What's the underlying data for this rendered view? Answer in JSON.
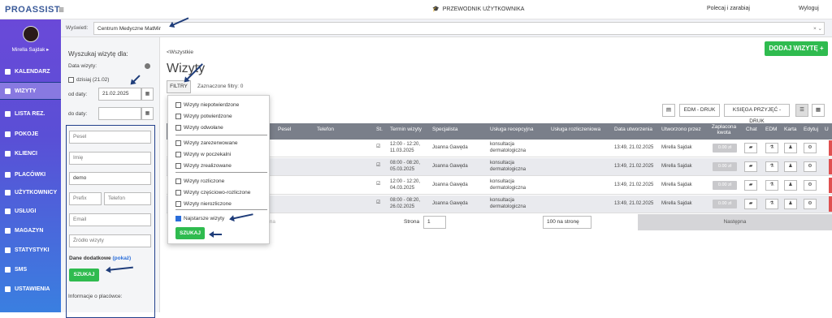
{
  "top": {
    "logo": "PROASSIST",
    "guide": "PRZEWODNIK UŻYTKOWNIKA",
    "refer": "Polecaj i zarabiaj",
    "logout": "Wyloguj"
  },
  "user": {
    "name": "Mirella Sajdak ▸"
  },
  "nav": [
    {
      "label": "KALENDARZ",
      "icon": "calendar-icon"
    },
    {
      "label": "WIZYTY",
      "icon": "list-icon"
    },
    {
      "label": "LISTA REZ.",
      "icon": "list-icon"
    },
    {
      "label": "POKOJE",
      "icon": "room-icon"
    },
    {
      "label": "KLIENCI",
      "icon": "users-icon"
    },
    {
      "label": "PLACÓWKI",
      "icon": "location-icon"
    },
    {
      "label": "UŻYTKOWNICY",
      "icon": "user-icon"
    },
    {
      "label": "USŁUGI",
      "icon": "grid-icon"
    },
    {
      "label": "MAGAZYN",
      "icon": "box-icon"
    },
    {
      "label": "STATYSTYKI",
      "icon": "chart-icon"
    },
    {
      "label": "SMS",
      "icon": "sms-icon"
    },
    {
      "label": "USTAWIENIA",
      "icon": "gear-icon"
    }
  ],
  "filter": {
    "label": "Wyświetl:",
    "value": "Centrum Medyczne MatMir",
    "clear": "× ⌄"
  },
  "search": {
    "title": "Wyszukaj wizytę dla:",
    "dates_label": "Data wizyty:",
    "today": "dzisiaj (21.02)",
    "from_label": "od daty:",
    "from_value": "21.02.2025",
    "to_label": "do daty:",
    "pesel": "Pesel",
    "imie": "Imię",
    "nazwisko": "demo",
    "prefix": "Prefix",
    "phone": "Telefon",
    "email": "Email",
    "source": "Źródło wizyty",
    "extra": "Dane dodatkowe",
    "extra_link": "(pokaż)",
    "button": "SZUKAJ",
    "places": "Informacje o placówce:"
  },
  "main": {
    "crumb": "<Wszystkie",
    "title": "Wizyty",
    "add": "DODAJ WIZYTĘ +",
    "filters": "FILTRY",
    "selected": "Zaznaczone filtry: 0",
    "edm": "EDM - DRUK",
    "book": "KSIĘGA PRZYJĘĆ - DRUK"
  },
  "headers": [
    "Pesel",
    "Telefon",
    "St.",
    "Termin wizyty",
    "Specjalista",
    "Usługa recepcyjna",
    "Usługa rozliczeniowa",
    "Data utworzenia",
    "Utworzono przez",
    "Zapłacona kwota",
    "Chat",
    "EDM",
    "Karta",
    "Edytuj",
    "U"
  ],
  "rows": [
    {
      "term": "12:00 - 12:20, 11.03.2025",
      "spec": "Joanna Gawęda",
      "service": "konsultacja dermatologiczna",
      "created": "13:49, 21.02.2025",
      "by": "Mirella Sajdak",
      "paid": "0.00 zł"
    },
    {
      "term": "08:00 - 08:20, 05.03.2025",
      "spec": "Joanna Gawęda",
      "service": "konsultacja dermatologiczna",
      "created": "13:49, 21.02.2025",
      "by": "Mirella Sajdak",
      "paid": "0.00 zł"
    },
    {
      "term": "12:00 - 12:20, 04.03.2025",
      "spec": "Joanna Gawęda",
      "service": "konsultacja dermatologiczna",
      "created": "13:49, 21.02.2025",
      "by": "Mirella Sajdak",
      "paid": "0.00 zł"
    },
    {
      "term": "08:00 - 08:20, 26.02.2025",
      "spec": "Joanna Gawęda",
      "service": "konsultacja dermatologiczna",
      "created": "13:49, 21.02.2025",
      "by": "Mirella Sajdak",
      "paid": "0.00 zł"
    }
  ],
  "pager": {
    "page_label": "Strona",
    "page": "1",
    "per_page": "100 na stronę",
    "next": "Następna",
    "prev_partial": "ma"
  },
  "dropdown": {
    "items": [
      "Wizyty niepotwierdzone",
      "Wizyty potwierdzone",
      "Wizyty odwołane",
      "Wizyty zarezerwowane",
      "Wizyty w poczekalni",
      "Wizyty zrealizowane",
      "Wizyty rozliczone",
      "Wizyty częściowo-rozliczone",
      "Wizyty nierozliczone",
      "Najstarsze wizyty"
    ],
    "button": "SZUKAJ"
  }
}
